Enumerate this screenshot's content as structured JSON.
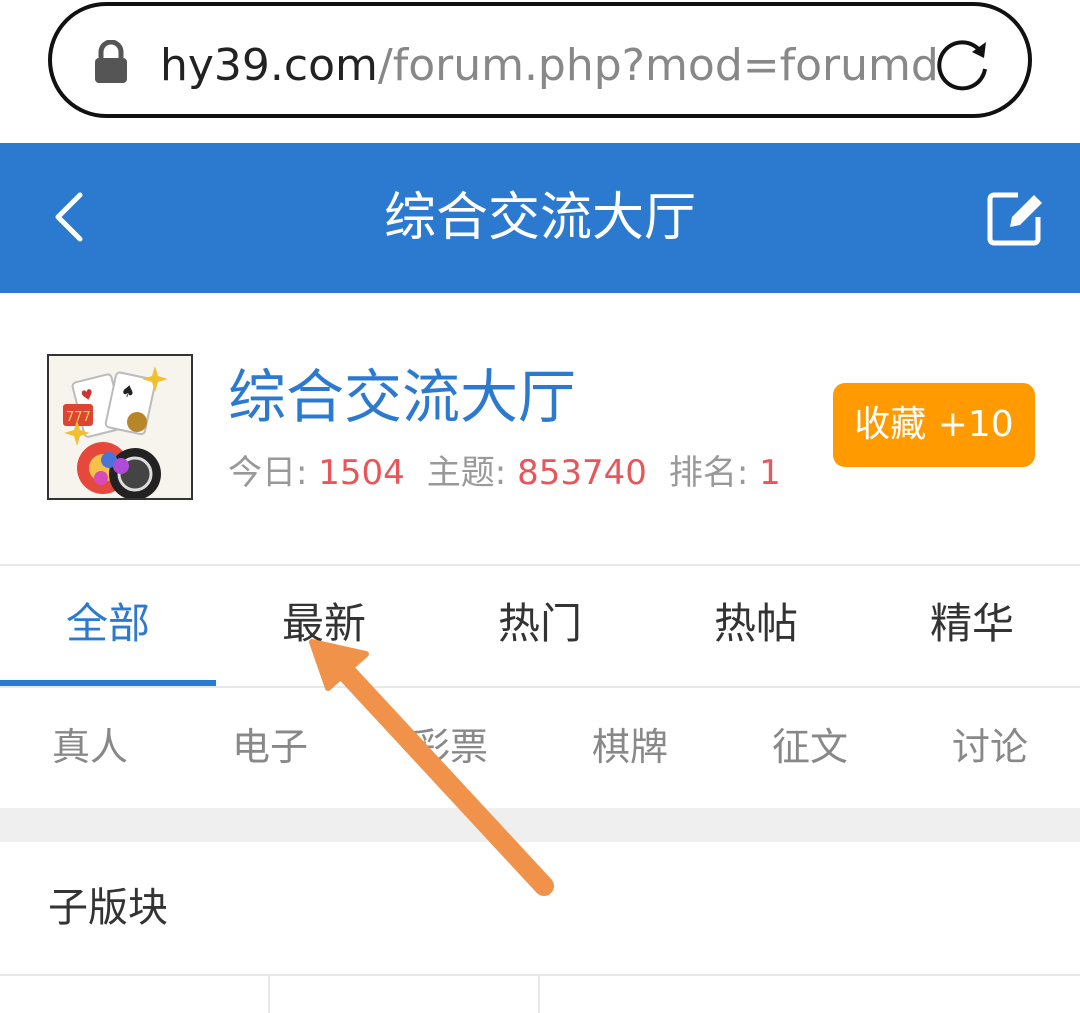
{
  "browser": {
    "url_host": "hy39.com",
    "url_path": "/forum.php?mod=forumd"
  },
  "header": {
    "title": "综合交流大厅"
  },
  "forum": {
    "name": "综合交流大厅",
    "today_label": "今日: ",
    "today_value": "1504",
    "topics_label": "主题: ",
    "topics_value": "853740",
    "rank_label": "排名: ",
    "rank_value": "1",
    "favorite_label": "收藏 +10"
  },
  "tabs": [
    {
      "label": "全部"
    },
    {
      "label": "最新"
    },
    {
      "label": "热门"
    },
    {
      "label": "热帖"
    },
    {
      "label": "精华"
    }
  ],
  "subcategories": [
    {
      "label": "真人"
    },
    {
      "label": "电子"
    },
    {
      "label": "彩票"
    },
    {
      "label": "棋牌"
    },
    {
      "label": "征文"
    },
    {
      "label": "讨论"
    }
  ],
  "section": {
    "title": "子版块"
  },
  "colors": {
    "brand": "#2c7ad0",
    "accent_orange": "#ff9a00",
    "number_red": "#e8565a",
    "annotation_arrow": "#f0924a"
  },
  "icons": [
    "lock-icon",
    "reload-icon",
    "back-icon",
    "edit-icon"
  ]
}
